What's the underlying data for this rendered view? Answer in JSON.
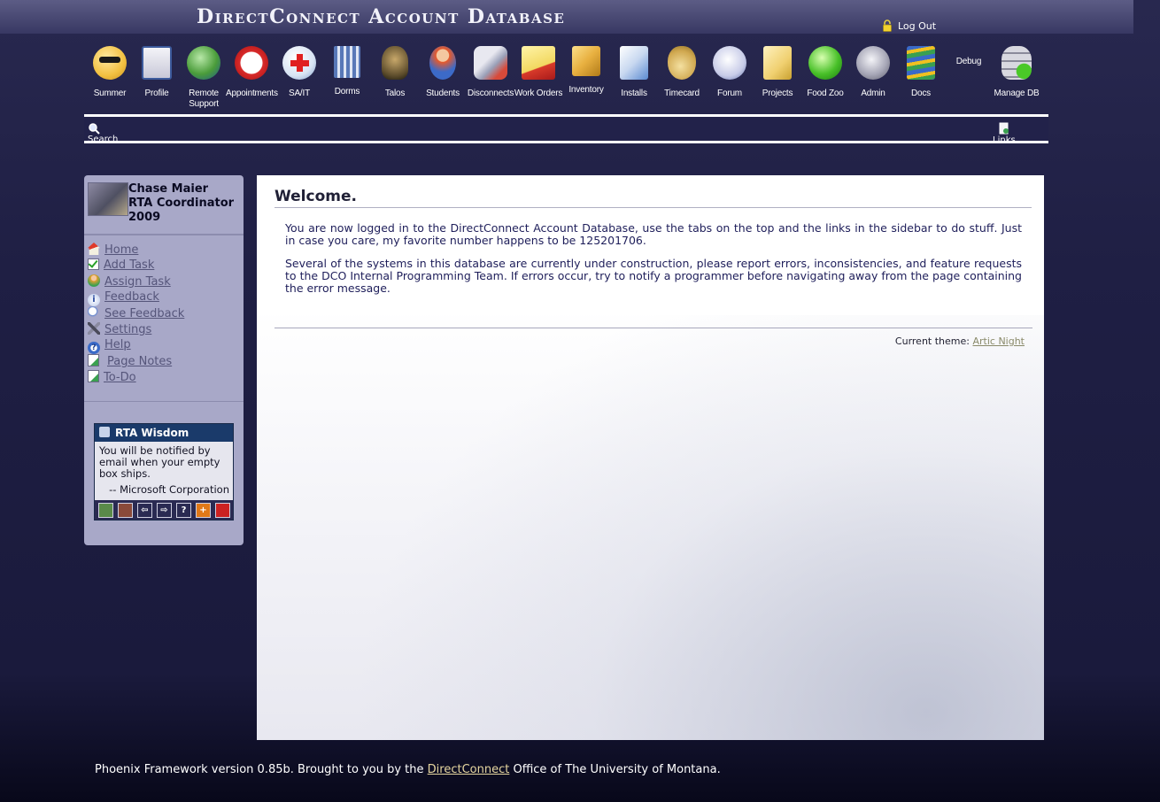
{
  "header": {
    "title": "DirectConnect Account Database",
    "logout_label": "Log Out"
  },
  "nav": {
    "items": [
      {
        "label": "Summer",
        "icon": "sunglasses-smiley-icon"
      },
      {
        "label": "Profile",
        "icon": "profile-icon"
      },
      {
        "label": "Remote Support",
        "icon": "globe-icon"
      },
      {
        "label": "Appointments",
        "icon": "alarm-clock-icon"
      },
      {
        "label": "SA/IT",
        "icon": "red-cross-icon"
      },
      {
        "label": "Dorms",
        "icon": "building-icon"
      },
      {
        "label": "Talos",
        "icon": "spartan-helmet-icon"
      },
      {
        "label": "Students",
        "icon": "student-icon"
      },
      {
        "label": "Disconnects",
        "icon": "disconnect-icon"
      },
      {
        "label": "Work Orders",
        "icon": "work-order-icon"
      },
      {
        "label": "Inventory",
        "icon": "box-icon"
      },
      {
        "label": "Installs",
        "icon": "installer-icon"
      },
      {
        "label": "Timecard",
        "icon": "money-bag-icon"
      },
      {
        "label": "Forum",
        "icon": "speech-bubble-icon"
      },
      {
        "label": "Projects",
        "icon": "folders-icon"
      },
      {
        "label": "Food Zoo",
        "icon": "apple-icon"
      },
      {
        "label": "Admin",
        "icon": "gears-icon"
      },
      {
        "label": "Docs",
        "icon": "books-icon"
      },
      {
        "label": "Debug",
        "icon": ""
      },
      {
        "label": "Manage DB",
        "icon": "database-check-icon"
      }
    ]
  },
  "toolbar": {
    "search_label": "Search",
    "links_label": "Links"
  },
  "user": {
    "name": "Chase Maier",
    "role": "RTA Coordinator",
    "year": "2009"
  },
  "sidebar": {
    "links": [
      {
        "label": "Home",
        "icon": "home-icon"
      },
      {
        "label": "Add Task",
        "icon": "checkbox-icon"
      },
      {
        "label": "Assign Task",
        "icon": "assign-user-icon"
      },
      {
        "label": "Feedback",
        "icon": "info-icon"
      },
      {
        "label": "See Feedback",
        "icon": "magnifier-icon"
      },
      {
        "label": "Settings",
        "icon": "tools-icon"
      },
      {
        "label": "Help",
        "icon": "help-icon"
      },
      {
        "label": "Page Notes",
        "icon": "note-edit-icon"
      },
      {
        "label": "To-Do",
        "icon": "todo-icon"
      }
    ]
  },
  "wisdom": {
    "title": "RTA Wisdom",
    "quote": "You will be notified by email when your empty box ships.",
    "author": "-- Microsoft Corporation",
    "buttons": [
      {
        "label": "",
        "icon": "thumbs-up-icon",
        "color": "#5a8a4a"
      },
      {
        "label": "",
        "icon": "thumbs-down-icon",
        "color": "#8a4a3a"
      },
      {
        "label": "⇦",
        "icon": "arrow-left-icon",
        "color": "#2a2a52"
      },
      {
        "label": "⇨",
        "icon": "arrow-right-icon",
        "color": "#2a2a52"
      },
      {
        "label": "?",
        "icon": "question-icon",
        "color": "#2a2a52"
      },
      {
        "label": "+",
        "icon": "plus-icon",
        "color": "#e07818"
      },
      {
        "label": "",
        "icon": "delete-icon",
        "color": "#cc2222"
      }
    ]
  },
  "main": {
    "title": "Welcome.",
    "para1": "You are now logged in to the DirectConnect Account Database, use the tabs on the top and the links in the sidebar to do stuff. Just in case you care, my favorite number happens to be 125201706.",
    "para2": "Several of the systems in this database are currently under construction, please report errors, inconsistencies, and feature requests to the DCO Internal Programming Team. If errors occur, try to notify a programmer before navigating away from the page containing the error message.",
    "theme_label": "Current theme:",
    "theme_value": "Artic Night"
  },
  "footer": {
    "text_before": "Phoenix Framework version 0.85b. Brought to you by the ",
    "link": "DirectConnect",
    "text_after": " Office of The University of Montana."
  },
  "colors": {
    "background": "#1f1f44",
    "link": "#55557a",
    "footer_link": "#e6d6a0",
    "wisdom_header": "#1a3a6a"
  }
}
